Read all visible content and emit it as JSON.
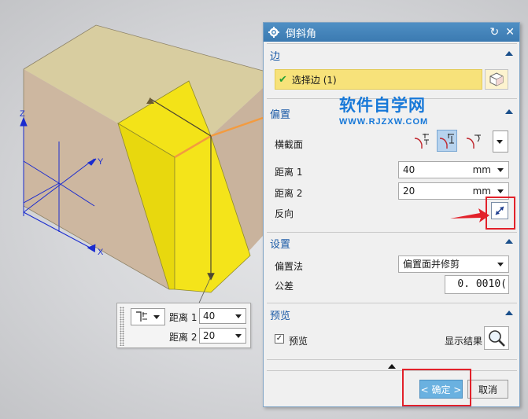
{
  "dialog": {
    "title": "倒斜角",
    "sections": {
      "edge": {
        "title": "边",
        "select_label": "选择边 (1)"
      },
      "offset": {
        "title": "偏置",
        "cross_section_label": "横截面",
        "distance1_label": "距离 1",
        "distance1_value": "40",
        "distance1_unit": "mm",
        "distance2_label": "距离 2",
        "distance2_value": "20",
        "distance2_unit": "mm",
        "reverse_label": "反向"
      },
      "settings": {
        "title": "设置",
        "offset_method_label": "偏置法",
        "offset_method_value": "偏置面并修剪",
        "tolerance_label": "公差",
        "tolerance_value": "0. 0010("
      },
      "preview": {
        "title": "预览",
        "preview_label": "预览",
        "preview_checked": true,
        "show_result_label": "显示结果"
      }
    },
    "ok_label": "< 确定 >",
    "cancel_label": "取消"
  },
  "mini_toolbar": {
    "distance1_label": "距离 1",
    "distance1_value": "40",
    "distance2_label": "距离 2",
    "distance2_value": "20"
  },
  "axes": {
    "z": "Z",
    "y": "Y",
    "x": "X"
  },
  "watermark": {
    "title": "软件自学网",
    "url": "WWW.RJZXW.COM"
  },
  "icons": {
    "title": "gear-icon",
    "reset": "reset-icon",
    "close": "close-icon",
    "check": "check-icon",
    "cube": "cube-icon",
    "reverse": "reverse-direction-icon",
    "magnifier": "magnifier-icon"
  },
  "colors": {
    "titlebar": "#4586bd",
    "section_header": "#1a5aa6",
    "selection_highlight": "#f7e27a",
    "chamfer_face": "#f0e11e",
    "ok_button": "#6ab1e0",
    "annotation_red": "#e2212a"
  }
}
